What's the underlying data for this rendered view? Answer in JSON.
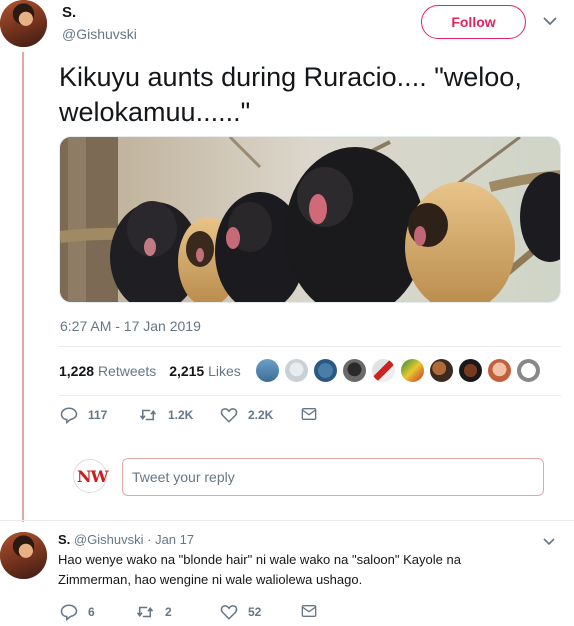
{
  "tweet": {
    "author_name": "S.",
    "author_handle": "@Gishuvski",
    "follow_label": "Follow",
    "text": "Kikuyu aunts during Ruracio.... \"weloo, welokamuu......\"",
    "timestamp": "6:27 AM - 17 Jan 2019",
    "retweets_count": "1,228",
    "retweets_label": "Retweets",
    "likes_count": "2,215",
    "likes_label": "Likes",
    "actions": {
      "reply_count": "117",
      "retweet_count": "1.2K",
      "like_count": "2.2K"
    },
    "media_icon": "monkeys-photo"
  },
  "reply_composer": {
    "placeholder": "Tweet your reply",
    "avatar_logo_text": "NW"
  },
  "reply": {
    "author_name": "S.",
    "author_handle": "@Gishuvski",
    "separator": "·",
    "date": "Jan 17",
    "text": "Hao wenye wako na \"blonde hair\" ni wale wako na \"saloon\" Kayole na Zimmerman, hao wengine ni wale waliolewa ushago.",
    "actions": {
      "reply_count": "6",
      "retweet_count": "2",
      "like_count": "52"
    }
  },
  "colors": {
    "accent": "#e0245e",
    "muted": "#657786",
    "text": "#14171a",
    "thread_line": "#e1a8a8"
  }
}
